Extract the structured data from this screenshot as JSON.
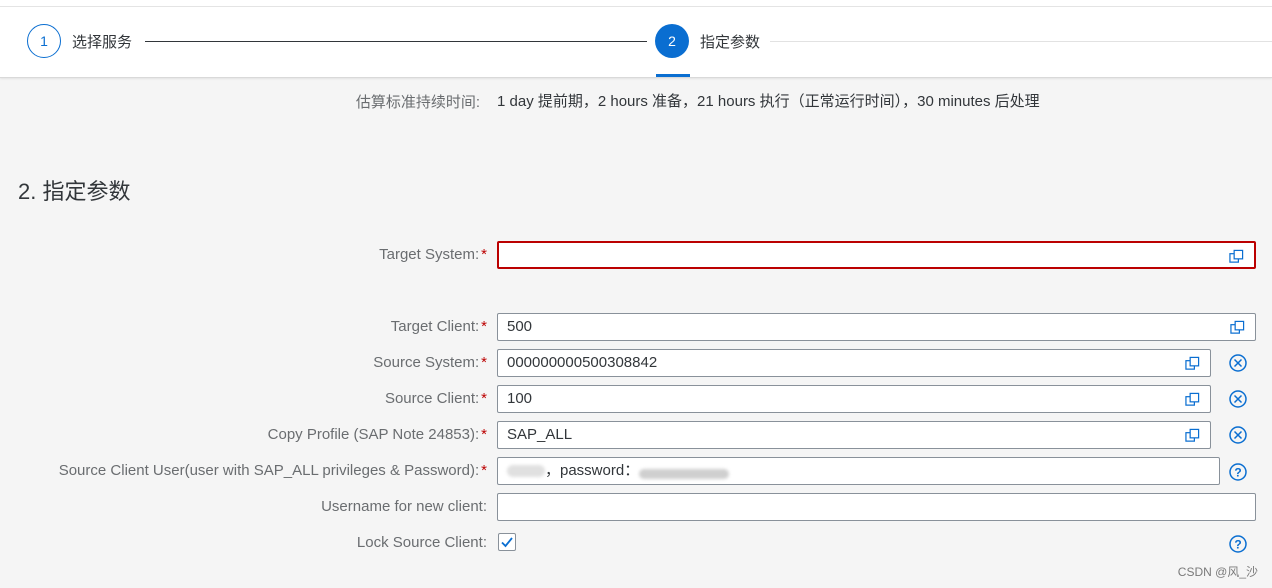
{
  "steps": [
    {
      "number": "1",
      "label": "选择服务"
    },
    {
      "number": "2",
      "label": "指定参数"
    }
  ],
  "estimate": {
    "label": "估算标准持续时间:",
    "value": "1 day 提前期，2 hours 准备，21 hours 执行（正常运行时间），30 minutes 后处理"
  },
  "section_title": "2. 指定参数",
  "fields": {
    "target_system": {
      "label": "Target System:",
      "required": "*",
      "value": ""
    },
    "target_client": {
      "label": "Target Client:",
      "required": "*",
      "value": "500"
    },
    "source_system": {
      "label": "Source System:",
      "required": "*",
      "value": "000000000500308842"
    },
    "source_client": {
      "label": "Source Client:",
      "required": "*",
      "value": "100"
    },
    "copy_profile": {
      "label": "Copy Profile (SAP Note 24853):",
      "required": "*",
      "value": "SAP_ALL"
    },
    "source_client_user": {
      "label": "Source Client User(user with SAP_ALL privileges & Password):",
      "required": "*",
      "value_mid": "，password："
    },
    "username_new_client": {
      "label": "Username for new client:",
      "value": ""
    },
    "lock_source_client": {
      "label": "Lock Source Client:",
      "checked": true
    }
  },
  "icons": {
    "value_help": "value-help-icon",
    "clear": "clear-icon",
    "help": "help-icon"
  },
  "colors": {
    "accent": "#0a6ed1",
    "error": "#bb0000"
  },
  "watermark": "CSDN @风_沙"
}
